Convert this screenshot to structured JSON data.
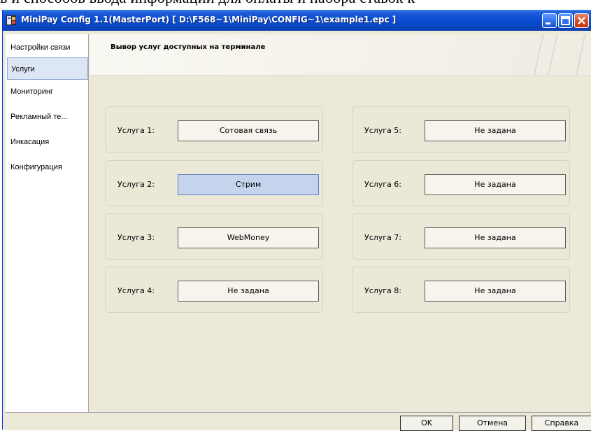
{
  "background_text": "в и способов ввода информации для оплаты и набора ставок к",
  "window": {
    "title": "MiniPay Config 1.1(MasterPort) [ D:\\F568~1\\MiniPay\\CONFIG~1\\example1.epc ]",
    "titlebar_color": "#0a4fd1"
  },
  "sidebar": {
    "items": [
      {
        "label": "Настройки связи"
      },
      {
        "label": "Услуги"
      },
      {
        "label": "Мониторинг"
      },
      {
        "label": "Рекламный те..."
      },
      {
        "label": "Инкасация"
      },
      {
        "label": "Конфигурация"
      }
    ],
    "selected": "Услуги"
  },
  "main": {
    "header": "Вывор услуг доступных на терминале",
    "services": [
      {
        "label": "Услуга 1:",
        "value": "Сотовая связь"
      },
      {
        "label": "Услуга 2:",
        "value": "Стрим"
      },
      {
        "label": "Услуга 3:",
        "value": "WebMoney"
      },
      {
        "label": "Услуга 4:",
        "value": "Не задана"
      },
      {
        "label": "Услуга 5:",
        "value": "Не задана"
      },
      {
        "label": "Услуга 6:",
        "value": "Не задана"
      },
      {
        "label": "Услуга 7:",
        "value": "Не задана"
      },
      {
        "label": "Услуга 8:",
        "value": "Не задана"
      }
    ]
  },
  "buttons": {
    "ok": "OK",
    "cancel": "Отмена",
    "help": "Справка"
  }
}
